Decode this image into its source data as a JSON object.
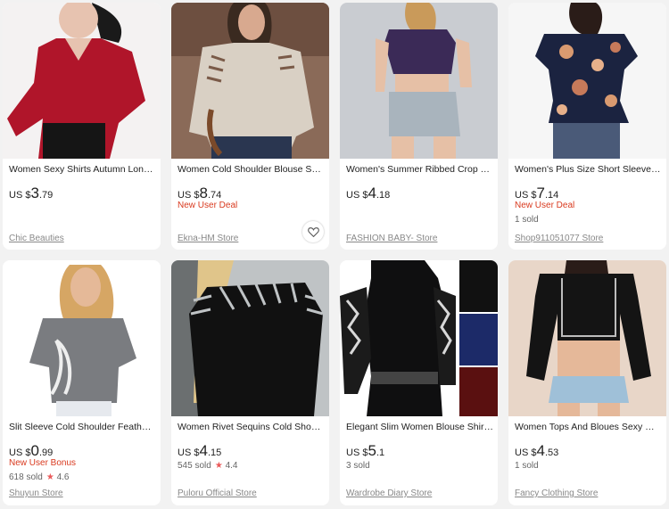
{
  "products": [
    {
      "title": "Women Sexy Shirts Autumn Long ...",
      "currency": "US $",
      "price_int": "3",
      "price_dec": ".79",
      "deal": "",
      "sold": "",
      "rating": "",
      "store": "Chic Beauties",
      "wishlist": false,
      "image_icon": "product-photo-red-knit-top"
    },
    {
      "title": "Women Cold Shoulder Blouse Soli...",
      "currency": "US $",
      "price_int": "8",
      "price_dec": ".74",
      "deal": "New User Deal",
      "sold": "",
      "rating": "",
      "store": "Ekna-HM Store",
      "wishlist": true,
      "image_icon": "product-photo-beige-cutout-top"
    },
    {
      "title": "Women's Summer Ribbed Crop To...",
      "currency": "US $",
      "price_int": "4",
      "price_dec": ".18",
      "deal": "",
      "sold": "",
      "rating": "",
      "store": "FASHION BABY- Store",
      "wishlist": false,
      "image_icon": "product-photo-purple-crop-top"
    },
    {
      "title": "Women's Plus Size Short Sleeve Sh...",
      "currency": "US $",
      "price_int": "7",
      "price_dec": ".14",
      "deal": "New User Deal",
      "sold": "1 sold",
      "rating": "",
      "store": "Shop911051077 Store",
      "wishlist": false,
      "image_icon": "product-photo-floral-blouse"
    },
    {
      "title": "Slit Sleeve Cold Shoulder Feather P...",
      "currency": "US $",
      "price_int": "0",
      "price_dec": ".99",
      "deal": "New User Bonus",
      "sold": "618 sold",
      "rating": "4.6",
      "store": "Shuyun Store",
      "wishlist": false,
      "image_icon": "product-photo-grey-feather-tee"
    },
    {
      "title": "Women Rivet Sequins Cold Should...",
      "currency": "US $",
      "price_int": "4",
      "price_dec": ".15",
      "deal": "",
      "sold": "545 sold",
      "rating": "4.4",
      "store": "Puloru Official Store",
      "wishlist": false,
      "image_icon": "product-photo-black-strappy-top"
    },
    {
      "title": "Elegant Slim Women Blouse Shirts ...",
      "currency": "US $",
      "price_int": "5",
      "price_dec": ".1",
      "deal": "",
      "sold": "3 sold",
      "rating": "",
      "store": "Wardrobe Diary Store",
      "wishlist": false,
      "image_icon": "product-photo-black-turtleneck"
    },
    {
      "title": "Women Tops And Bloues Sexy Wo...",
      "currency": "US $",
      "price_int": "4",
      "price_dec": ".53",
      "deal": "",
      "sold": "1 sold",
      "rating": "",
      "store": "Fancy Clothing Store",
      "wishlist": false,
      "image_icon": "product-photo-black-crop-top"
    }
  ],
  "colors": {
    "deal": "#d93a1f",
    "star": "#ea5a5a",
    "background": "#f2f2f2"
  }
}
